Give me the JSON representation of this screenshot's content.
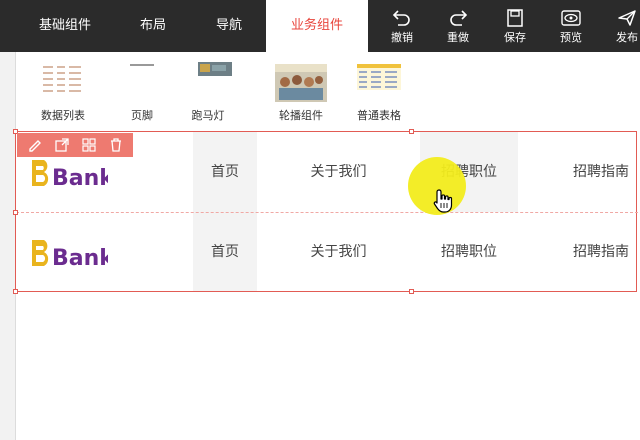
{
  "topbar": {
    "tabs": [
      {
        "label": "基础组件"
      },
      {
        "label": "布局"
      },
      {
        "label": "导航"
      },
      {
        "label": "业务组件",
        "active": true
      }
    ],
    "tools": [
      {
        "label": "撤销",
        "icon": "undo-icon"
      },
      {
        "label": "重做",
        "icon": "redo-icon"
      },
      {
        "label": "保存",
        "icon": "save-icon"
      },
      {
        "label": "预览",
        "icon": "preview-icon"
      },
      {
        "label": "发布",
        "icon": "publish-icon"
      }
    ]
  },
  "components": [
    {
      "label": "数据列表",
      "icon": "data-list-thumbnail"
    },
    {
      "label": "页脚",
      "icon": "footer-thumbnail"
    },
    {
      "label": "跑马灯",
      "icon": "marquee-thumbnail"
    },
    {
      "label": "轮播组件",
      "icon": "carousel-thumbnail"
    },
    {
      "label": "普通表格",
      "icon": "table-thumbnail"
    }
  ],
  "nav_rows": [
    {
      "logo": "Bank",
      "items": [
        "首页",
        "关于我们",
        "招聘职位",
        "招聘指南"
      ]
    },
    {
      "logo": "Bank",
      "items": [
        "首页",
        "关于我们",
        "招聘职位",
        "招聘指南"
      ]
    }
  ],
  "selection_toolbar": [
    "edit-icon",
    "open-icon",
    "copy-icon",
    "delete-icon"
  ],
  "colors": {
    "accent": "#e8453c",
    "topbar": "#2b2b2b",
    "logo_gold": "#e9b41e",
    "logo_purple": "#6b2c8f"
  }
}
